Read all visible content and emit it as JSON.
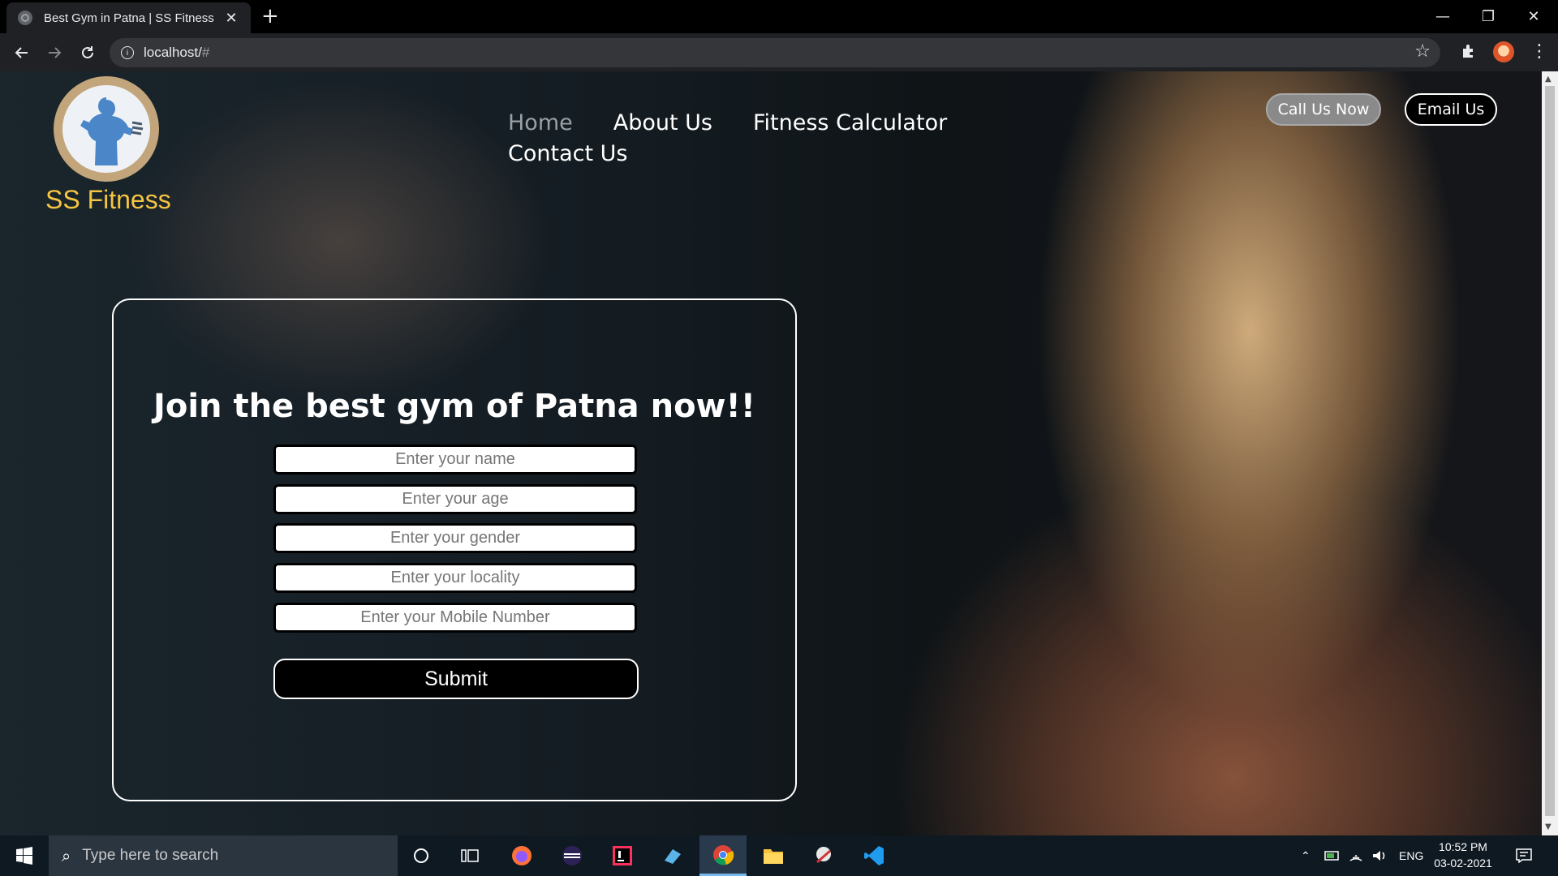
{
  "browser": {
    "tab_title": "Best Gym in Patna | SS Fitness",
    "tab_close": "✕",
    "new_tab": "+",
    "url_host": "localhost/",
    "url_hash": "#",
    "window_controls": {
      "minimize": "—",
      "restore": "❐",
      "close": "✕"
    }
  },
  "site": {
    "brand": "SS Fitness",
    "nav": [
      "Home",
      "About Us",
      "Fitness Calculator",
      "Contact Us"
    ],
    "active_nav": "Home",
    "call_button": "Call Us Now",
    "email_button": "Email Us"
  },
  "form": {
    "title": "Join the best gym of Patna now!!",
    "placeholders": {
      "name": "Enter your name",
      "age": "Enter your age",
      "gender": "Enter your gender",
      "locality": "Enter your locality",
      "mobile": "Enter your Mobile Number"
    },
    "submit": "Submit"
  },
  "taskbar": {
    "search_placeholder": "Type here to search",
    "language": "ENG",
    "time": "10:52 PM",
    "date": "03-02-2021"
  },
  "colors": {
    "brand": "#f5c542",
    "logo_ring": "#c2a57a",
    "logo_figure": "#4a86c8"
  }
}
